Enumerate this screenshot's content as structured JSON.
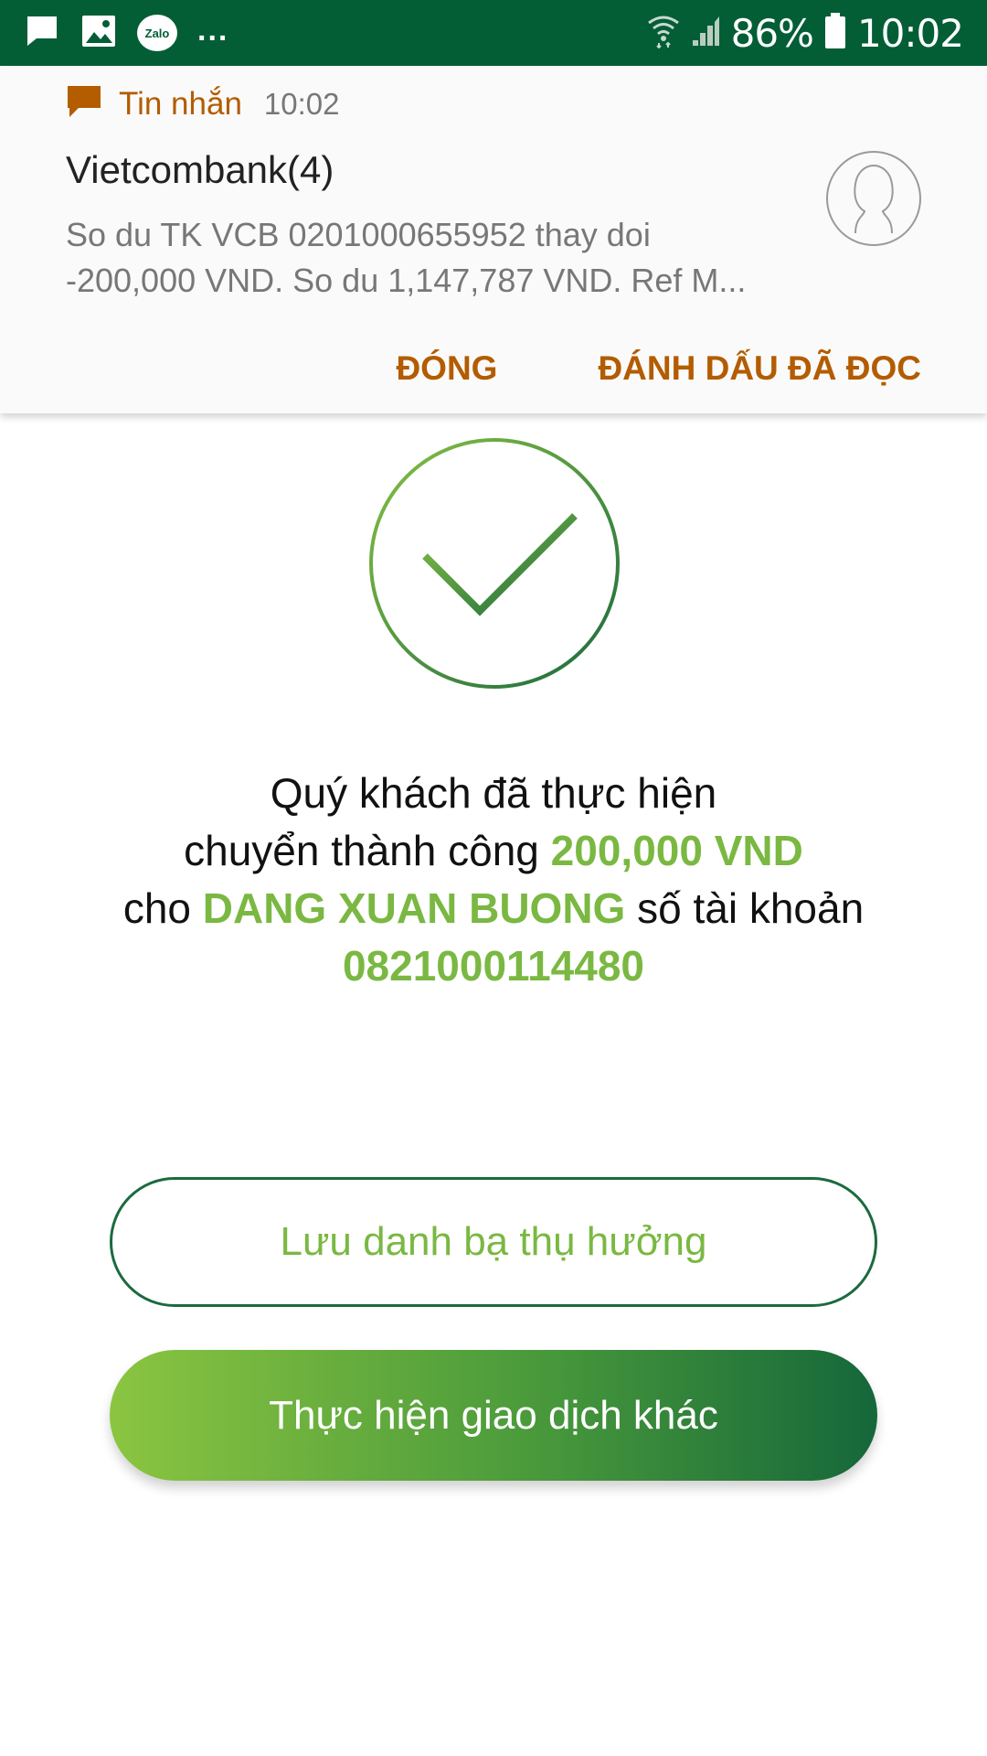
{
  "status_bar": {
    "left_icons": [
      "message-icon",
      "image-icon",
      "zalo-icon",
      "more-icon"
    ],
    "zalo_label": "Zalo",
    "more_label": "...",
    "battery_percent": "86%",
    "time": "10:02",
    "colors": {
      "background": "#035e36"
    }
  },
  "notification": {
    "app_name": "Tin nhắn",
    "time": "10:02",
    "sender": "Vietcombank(4)",
    "body_line1": "So du TK VCB 0201000655952 thay doi",
    "body_line2": "-200,000 VND. So du 1,147,787 VND. Ref M...",
    "action_close": "ĐÓNG",
    "action_mark_read": "ĐÁNH DẤU ĐÃ ĐỌC",
    "accent_color": "#b35c00"
  },
  "result": {
    "line1": "Quý khách đã thực hiện",
    "line2_prefix": "chuyển thành công",
    "amount": "200,000 VND",
    "line3_prefix": "cho",
    "recipient": "DANG XUAN BUONG",
    "line3_suffix": "số tài khoản",
    "account_number": "0821000114480",
    "highlight_color": "#7ab842"
  },
  "actions": {
    "save_beneficiary": "Lưu danh bạ thụ hưởng",
    "new_transaction": "Thực hiện giao dịch khác"
  }
}
